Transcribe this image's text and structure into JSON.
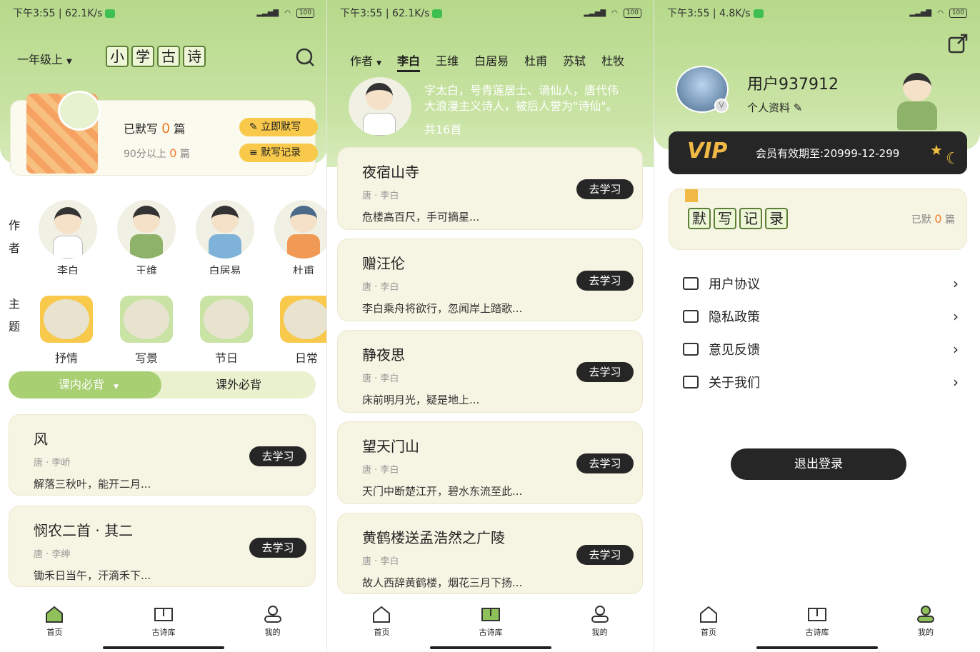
{
  "status": [
    {
      "time": "下午3:55 | 62.1K/s"
    },
    {
      "time": "下午3:55 | 62.1K/s"
    },
    {
      "time": "下午3:55 | 4.8K/s"
    }
  ],
  "battery": "100",
  "nav": [
    "首页",
    "古诗库",
    "我的"
  ],
  "home": {
    "grade": "一年级上",
    "title_chars": [
      "小",
      "学",
      "古",
      "诗"
    ],
    "recite_label_a": "已默写",
    "recite_count": "0",
    "recite_unit": "篇",
    "score_label": "90分以上",
    "score_count": "0",
    "score_unit": "篇",
    "btn_recite": "立即默写",
    "btn_record": "默写记录",
    "author_label": [
      "作",
      "者"
    ],
    "poets": [
      "李白",
      "王维",
      "白居易",
      "杜甫"
    ],
    "theme_label": [
      "主",
      "题"
    ],
    "themes": [
      "抒情",
      "写景",
      "节日",
      "日常"
    ],
    "tab_in": "课内必背",
    "tab_out": "课外必背",
    "poems": [
      {
        "title": "风",
        "meta": "唐 · 李峤",
        "line": "解落三秋叶，能开二月..."
      },
      {
        "title": "悯农二首 · 其二",
        "meta": "唐 · 李绅",
        "line": "锄禾日当午，汗滴禾下..."
      }
    ],
    "go": "去学习"
  },
  "library": {
    "tabs": [
      "作者",
      "李白",
      "王维",
      "白居易",
      "杜甫",
      "苏轼",
      "杜牧"
    ],
    "bio_1": "字太白，号青莲居士、谪仙人，唐代伟",
    "bio_2": "大浪漫主义诗人，被后人誉为\"诗仙\"。",
    "count": "共16首",
    "go": "去学习",
    "poems": [
      {
        "title": "夜宿山寺",
        "meta": "唐 · 李白",
        "line": "危楼高百尺，手可摘星..."
      },
      {
        "title": "赠汪伦",
        "meta": "唐 · 李白",
        "line": "李白乘舟将欲行，忽闻岸上踏歌..."
      },
      {
        "title": "静夜思",
        "meta": "唐 · 李白",
        "line": "床前明月光，疑是地上..."
      },
      {
        "title": "望天门山",
        "meta": "唐 · 李白",
        "line": "天门中断楚江开，碧水东流至此..."
      },
      {
        "title": "黄鹤楼送孟浩然之广陵",
        "meta": "唐 · 李白",
        "line": "故人西辞黄鹤楼，烟花三月下扬..."
      }
    ]
  },
  "profile": {
    "username": "用户937912",
    "profile_link": "个人资料",
    "vip": "VIP",
    "vip_expiry": "会员有效期至:20999-12-299",
    "record_chars": [
      "默",
      "写",
      "记",
      "录"
    ],
    "record_label": "已默",
    "record_count": "0",
    "record_unit": "篇",
    "menu": [
      "用户协议",
      "隐私政策",
      "意见反馈",
      "关于我们"
    ],
    "logout": "退出登录"
  },
  "colors": {
    "accent_green": "#b6d98a",
    "card_bg": "#f6f4e2",
    "button_dark": "#262626",
    "count_orange": "#f07b2c"
  }
}
